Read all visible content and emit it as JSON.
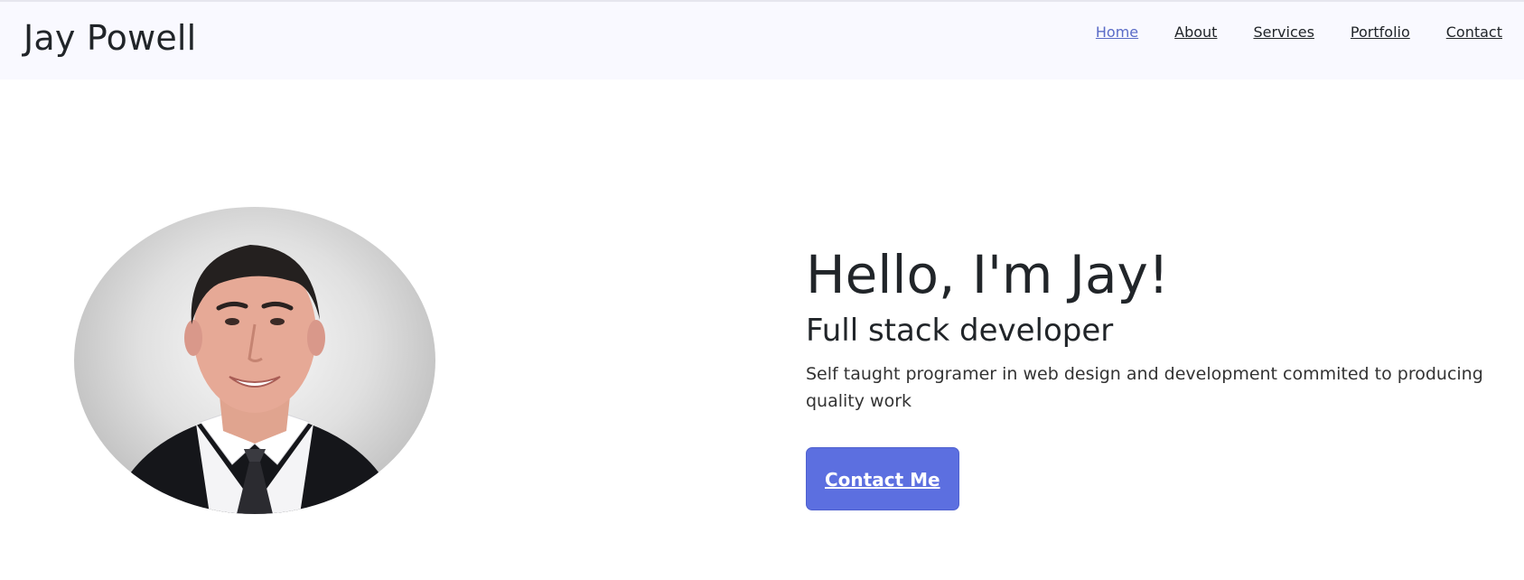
{
  "navbar": {
    "brand": "Jay Powell",
    "links": [
      {
        "label": "Home",
        "active": true
      },
      {
        "label": "About",
        "active": false
      },
      {
        "label": "Services",
        "active": false
      },
      {
        "label": "Portfolio",
        "active": false
      },
      {
        "label": "Contact",
        "active": false
      }
    ]
  },
  "hero": {
    "title": "Hello, I'm Jay!",
    "subtitle": "Full stack developer",
    "description": "Self taught programer in web design and development commited to producing quality work",
    "cta_label": "Contact Me",
    "image_icon": "profile-photo"
  },
  "colors": {
    "accent": "#5c6fe0",
    "active_link": "#5a6bc7",
    "navbar_bg": "#f9f9ff",
    "text": "#212529"
  }
}
